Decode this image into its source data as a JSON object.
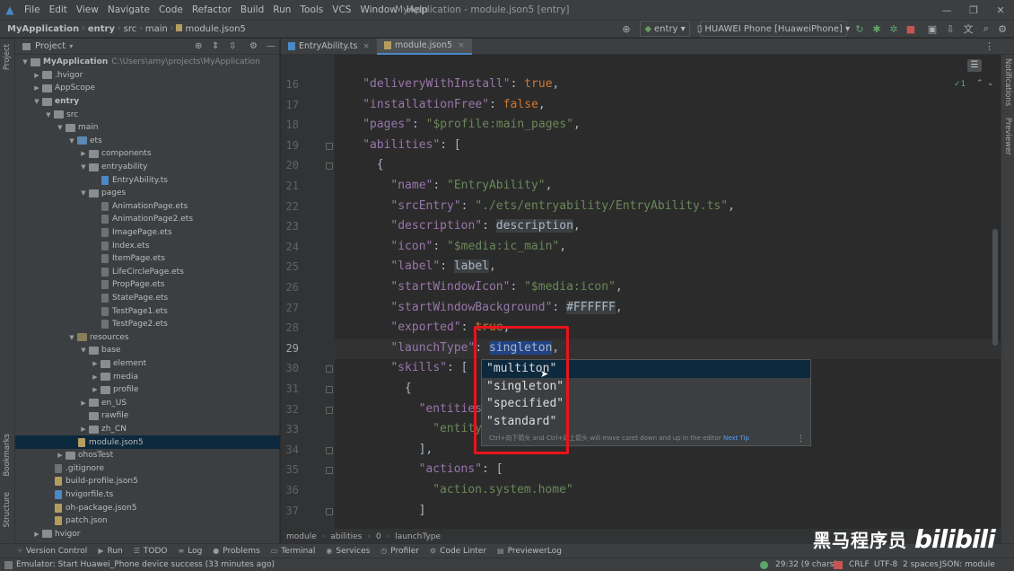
{
  "menubar": {
    "items": [
      "File",
      "Edit",
      "View",
      "Navigate",
      "Code",
      "Refactor",
      "Build",
      "Run",
      "Tools",
      "VCS",
      "Window",
      "Help"
    ],
    "window_title": "MyApplication - module.json5 [entry]"
  },
  "navbar": {
    "crumbs": [
      "MyApplication",
      "entry",
      "src",
      "main",
      "module.json5"
    ],
    "module_combo": "entry",
    "device_combo": "HUAWEI Phone [HuaweiPhone]"
  },
  "left_strip": {
    "project": "Project",
    "bookmarks": "Bookmarks",
    "structure": "Structure"
  },
  "right_strip": {
    "notifications": "Notifications",
    "previewer": "Previewer"
  },
  "project_panel": {
    "title": "Project",
    "tree": [
      {
        "label": "MyApplication",
        "muted": "C:\\Users\\amy\\projects\\MyApplication",
        "depth": 0,
        "kind": "folder",
        "open": true,
        "bold": true
      },
      {
        "label": ".hvigor",
        "depth": 1,
        "kind": "folder",
        "open": false
      },
      {
        "label": "AppScope",
        "depth": 1,
        "kind": "folder",
        "open": false
      },
      {
        "label": "entry",
        "depth": 1,
        "kind": "folder",
        "open": true,
        "bold": true
      },
      {
        "label": "src",
        "depth": 2,
        "kind": "folder",
        "open": true
      },
      {
        "label": "main",
        "depth": 3,
        "kind": "folder",
        "open": true
      },
      {
        "label": "ets",
        "depth": 4,
        "kind": "folder-src",
        "open": true
      },
      {
        "label": "components",
        "depth": 5,
        "kind": "folder",
        "open": false
      },
      {
        "label": "entryability",
        "depth": 5,
        "kind": "folder",
        "open": true
      },
      {
        "label": "EntryAbility.ts",
        "depth": 6,
        "kind": "file-ts"
      },
      {
        "label": "pages",
        "depth": 5,
        "kind": "folder",
        "open": true
      },
      {
        "label": "AnimationPage.ets",
        "depth": 6,
        "kind": "file"
      },
      {
        "label": "AnimationPage2.ets",
        "depth": 6,
        "kind": "file"
      },
      {
        "label": "ImagePage.ets",
        "depth": 6,
        "kind": "file"
      },
      {
        "label": "Index.ets",
        "depth": 6,
        "kind": "file"
      },
      {
        "label": "ItemPage.ets",
        "depth": 6,
        "kind": "file"
      },
      {
        "label": "LifeCirclePage.ets",
        "depth": 6,
        "kind": "file"
      },
      {
        "label": "PropPage.ets",
        "depth": 6,
        "kind": "file"
      },
      {
        "label": "StatePage.ets",
        "depth": 6,
        "kind": "file"
      },
      {
        "label": "TestPage1.ets",
        "depth": 6,
        "kind": "file"
      },
      {
        "label": "TestPage2.ets",
        "depth": 6,
        "kind": "file"
      },
      {
        "label": "resources",
        "depth": 4,
        "kind": "folder-res",
        "open": true
      },
      {
        "label": "base",
        "depth": 5,
        "kind": "folder",
        "open": true
      },
      {
        "label": "element",
        "depth": 6,
        "kind": "folder",
        "open": false
      },
      {
        "label": "media",
        "depth": 6,
        "kind": "folder",
        "open": false
      },
      {
        "label": "profile",
        "depth": 6,
        "kind": "folder",
        "open": false
      },
      {
        "label": "en_US",
        "depth": 5,
        "kind": "folder",
        "open": false
      },
      {
        "label": "rawfile",
        "depth": 5,
        "kind": "folder",
        "open": null
      },
      {
        "label": "zh_CN",
        "depth": 5,
        "kind": "folder",
        "open": false
      },
      {
        "label": "module.json5",
        "depth": 4,
        "kind": "file-json",
        "selected": true
      },
      {
        "label": "ohosTest",
        "depth": 3,
        "kind": "folder",
        "open": false
      },
      {
        "label": ".gitignore",
        "depth": 2,
        "kind": "file"
      },
      {
        "label": "build-profile.json5",
        "depth": 2,
        "kind": "file-json"
      },
      {
        "label": "hvigorfile.ts",
        "depth": 2,
        "kind": "file-ts"
      },
      {
        "label": "oh-package.json5",
        "depth": 2,
        "kind": "file-json"
      },
      {
        "label": "patch.json",
        "depth": 2,
        "kind": "file-json"
      },
      {
        "label": "hvigor",
        "depth": 1,
        "kind": "folder",
        "open": false
      }
    ]
  },
  "tabs": [
    {
      "label": "EntryAbility.ts",
      "active": false
    },
    {
      "label": "module.json5",
      "active": true
    }
  ],
  "editor": {
    "inspection": "✓1",
    "lines": [
      {
        "n": "16",
        "parts": [
          [
            "k",
            "\"deliveryWithInstall\""
          ],
          [
            "p",
            ": "
          ],
          [
            "b",
            "true"
          ],
          [
            "p",
            ","
          ]
        ],
        "indent": 2
      },
      {
        "n": "17",
        "parts": [
          [
            "k",
            "\"installationFree\""
          ],
          [
            "p",
            ": "
          ],
          [
            "b",
            "false"
          ],
          [
            "p",
            ","
          ]
        ],
        "indent": 2
      },
      {
        "n": "18",
        "parts": [
          [
            "k",
            "\"pages\""
          ],
          [
            "p",
            ": "
          ],
          [
            "s",
            "\"$profile:main_pages\""
          ],
          [
            "p",
            ","
          ]
        ],
        "indent": 2
      },
      {
        "n": "19",
        "parts": [
          [
            "k",
            "\"abilities\""
          ],
          [
            "p",
            ": ["
          ]
        ],
        "indent": 2
      },
      {
        "n": "20",
        "parts": [
          [
            "p",
            "{"
          ]
        ],
        "indent": 3
      },
      {
        "n": "21",
        "parts": [
          [
            "k",
            "\"name\""
          ],
          [
            "p",
            ": "
          ],
          [
            "s",
            "\"EntryAbility\""
          ],
          [
            "p",
            ","
          ]
        ],
        "indent": 4
      },
      {
        "n": "22",
        "parts": [
          [
            "k",
            "\"srcEntry\""
          ],
          [
            "p",
            ": "
          ],
          [
            "s",
            "\"./ets/entryability/EntryAbility.ts\""
          ],
          [
            "p",
            ","
          ]
        ],
        "indent": 4
      },
      {
        "n": "23",
        "parts": [
          [
            "k",
            "\"description\""
          ],
          [
            "p",
            ": "
          ],
          [
            "h",
            "description"
          ],
          [
            "p",
            ","
          ]
        ],
        "indent": 4
      },
      {
        "n": "24",
        "parts": [
          [
            "k",
            "\"icon\""
          ],
          [
            "p",
            ": "
          ],
          [
            "s",
            "\"$media:ic_main\""
          ],
          [
            "p",
            ","
          ]
        ],
        "indent": 4
      },
      {
        "n": "25",
        "parts": [
          [
            "k",
            "\"label\""
          ],
          [
            "p",
            ": "
          ],
          [
            "h",
            "label"
          ],
          [
            "p",
            ","
          ]
        ],
        "indent": 4
      },
      {
        "n": "26",
        "parts": [
          [
            "k",
            "\"startWindowIcon\""
          ],
          [
            "p",
            ": "
          ],
          [
            "s",
            "\"$media:icon\""
          ],
          [
            "p",
            ","
          ]
        ],
        "indent": 4
      },
      {
        "n": "27",
        "parts": [
          [
            "k",
            "\"startWindowBackground\""
          ],
          [
            "p",
            ": "
          ],
          [
            "h",
            "#FFFFFF"
          ],
          [
            "p",
            ","
          ]
        ],
        "indent": 4
      },
      {
        "n": "28",
        "parts": [
          [
            "k",
            "\"exported\""
          ],
          [
            "p",
            ": "
          ],
          [
            "b",
            "true"
          ],
          [
            "p",
            ","
          ]
        ],
        "indent": 4
      },
      {
        "n": "29",
        "parts": [
          [
            "k",
            "\"launchType\""
          ],
          [
            "p",
            ": "
          ],
          [
            "sel",
            "singleton"
          ],
          [
            "p",
            ","
          ]
        ],
        "indent": 4
      },
      {
        "n": "30",
        "parts": [
          [
            "k",
            "\"skills\""
          ],
          [
            "p",
            ": ["
          ]
        ],
        "indent": 4
      },
      {
        "n": "31",
        "parts": [
          [
            "p",
            "{"
          ]
        ],
        "indent": 5
      },
      {
        "n": "32",
        "parts": [
          [
            "k",
            "\"entities\""
          ],
          [
            "p",
            ": ["
          ]
        ],
        "indent": 6
      },
      {
        "n": "33",
        "parts": [
          [
            "s",
            "\"entity.system.home\""
          ]
        ],
        "indent": 7
      },
      {
        "n": "34",
        "parts": [
          [
            "p",
            "],"
          ]
        ],
        "indent": 6
      },
      {
        "n": "35",
        "parts": [
          [
            "k",
            "\"actions\""
          ],
          [
            "p",
            ": ["
          ]
        ],
        "indent": 6
      },
      {
        "n": "36",
        "parts": [
          [
            "s",
            "\"action.system.home\""
          ]
        ],
        "indent": 7
      },
      {
        "n": "37",
        "parts": [
          [
            "p",
            "]"
          ]
        ],
        "indent": 6
      }
    ]
  },
  "completion": {
    "items": [
      "\"multiton\"",
      "\"singleton\"",
      "\"specified\"",
      "\"standard\""
    ],
    "hint": "Ctrl+向下箭头 and Ctrl+向上箭头 will move caret down and up in the editor",
    "next_tip": "Next Tip"
  },
  "code_crumbs": [
    "module",
    "abilities",
    "0",
    "launchType"
  ],
  "bottom_tools": [
    {
      "icon": "⑂",
      "label": "Version Control"
    },
    {
      "icon": "▶",
      "label": "Run"
    },
    {
      "icon": "☰",
      "label": "TODO"
    },
    {
      "icon": "≡",
      "label": "Log"
    },
    {
      "icon": "●",
      "label": "Problems"
    },
    {
      "icon": "▭",
      "label": "Terminal"
    },
    {
      "icon": "◉",
      "label": "Services"
    },
    {
      "icon": "◷",
      "label": "Profiler"
    },
    {
      "icon": "⚙",
      "label": "Code Linter"
    },
    {
      "icon": "▤",
      "label": "PreviewerLog"
    }
  ],
  "status": {
    "message": "Emulator: Start Huawei_Phone device success (33 minutes ago)",
    "position": "29:32 (9 chars)",
    "line_sep": "CRLF",
    "encoding": "UTF-8",
    "indent": "2 spaces",
    "schema": "JSON: module"
  },
  "watermark": {
    "text": "黑马程序员",
    "logo": "bilibili"
  },
  "colors": {
    "accent": "#4a88c7",
    "highlight_box": "#e8141c",
    "selection": "#214283"
  }
}
